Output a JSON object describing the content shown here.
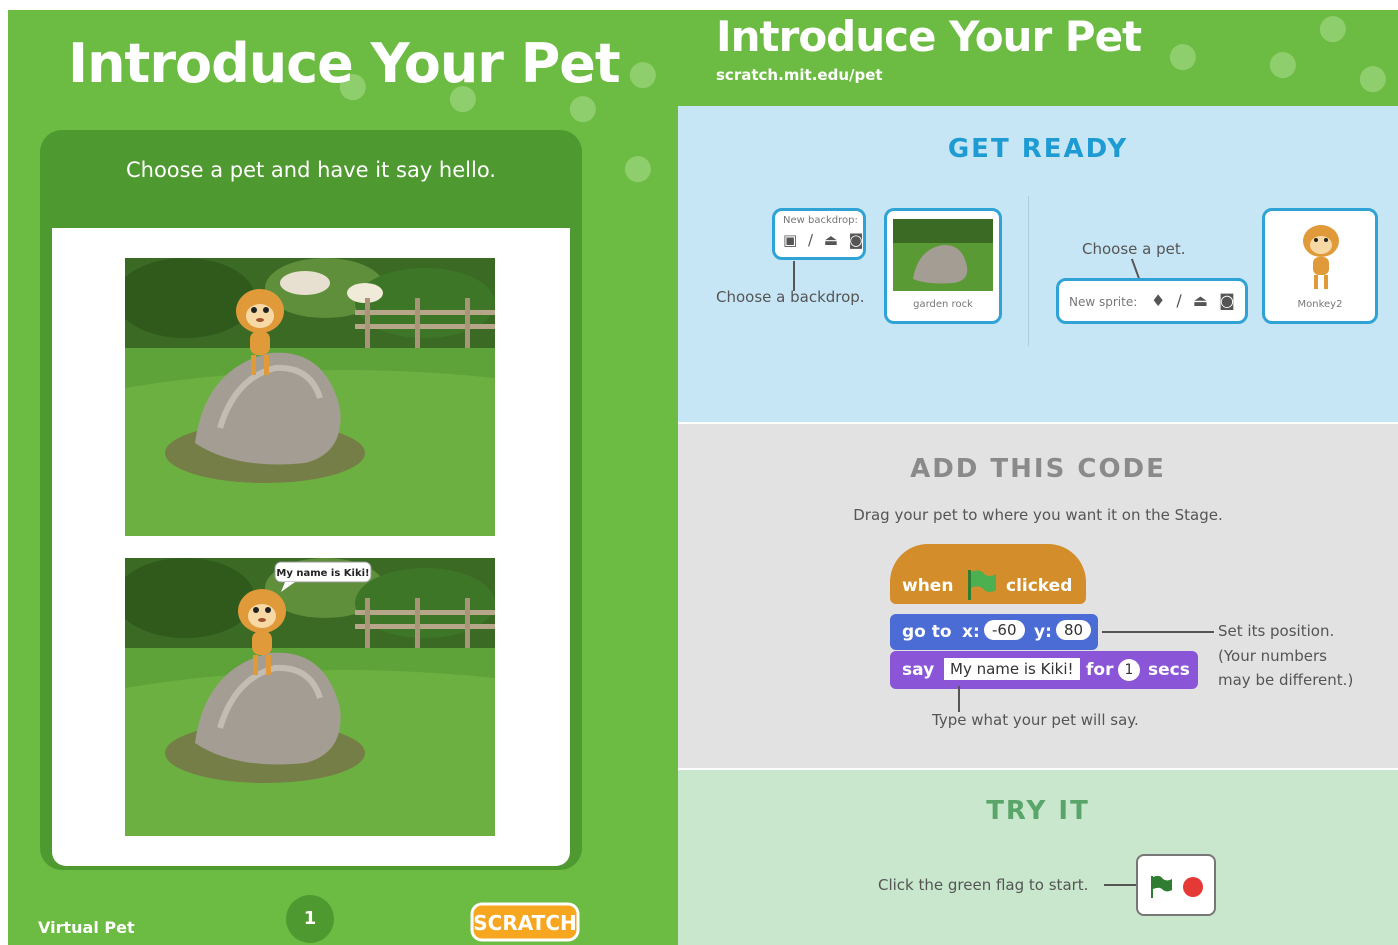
{
  "left": {
    "title": "Introduce Your Pet",
    "panel_heading": "Choose a pet and have it say hello.",
    "speech_bubble": "My name is Kiki!",
    "footer_label": "Virtual Pet",
    "page_number": "1",
    "logo_text": "SCRATCH"
  },
  "right": {
    "title": "Introduce Your Pet",
    "url": "scratch.mit.edu/pet",
    "get_ready": {
      "heading": "GET READY",
      "new_backdrop_label": "New backdrop:",
      "choose_backdrop": "Choose a backdrop.",
      "backdrop_name": "garden rock",
      "choose_pet": "Choose a pet.",
      "new_sprite_label": "New sprite:",
      "sprite_name": "Monkey2"
    },
    "add_code": {
      "heading": "ADD THIS CODE",
      "instruction": "Drag your pet to where you want it on the Stage.",
      "hat_when": "when",
      "hat_clicked": "clicked",
      "goto_word": "go to",
      "x_label": "x:",
      "x_value": "-60",
      "y_label": "y:",
      "y_value": "80",
      "say_word": "say",
      "say_text": "My name is Kiki!",
      "for_word": "for",
      "secs_value": "1",
      "secs_word": "secs",
      "note_position_1": "Set its position.",
      "note_position_2": "(Your numbers",
      "note_position_3": "may be different.)",
      "note_say": "Type what your pet will say."
    },
    "try_it": {
      "heading": "TRY IT",
      "instruction": "Click the green flag to start."
    }
  },
  "colors": {
    "card_green": "#6cbb43",
    "panel_green": "#4f9a30",
    "get_ready_bg": "#c6e6f5",
    "add_code_bg": "#e2e2e2",
    "try_it_bg": "#c8e7cd",
    "event_block": "#d38d2a",
    "motion_block": "#4a6cd4",
    "looks_block": "#8a55d7"
  },
  "icons": [
    "paw-print-icon",
    "green-flag-icon",
    "stop-sign-icon",
    "paint-brush-icon",
    "upload-icon",
    "camera-icon",
    "image-icon"
  ]
}
